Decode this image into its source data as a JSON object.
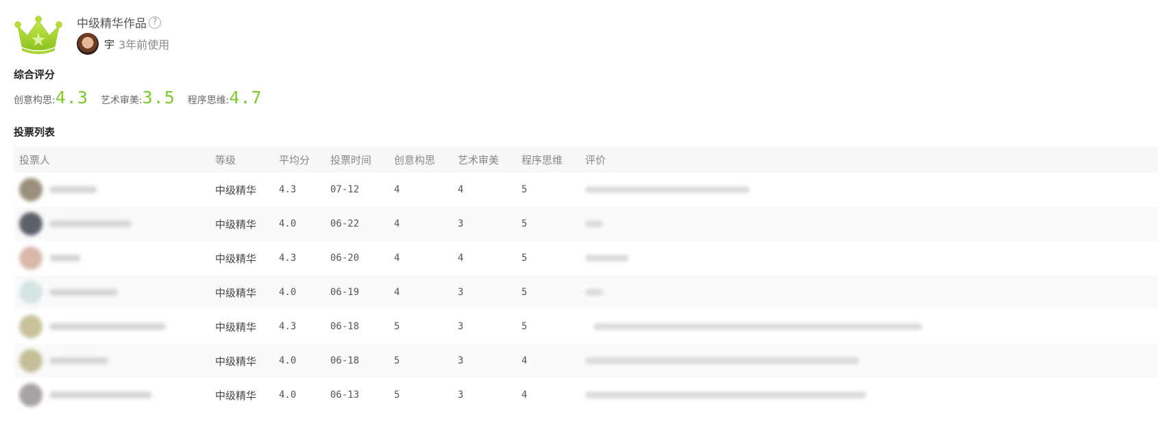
{
  "header": {
    "title": "中级精华作品",
    "help_icon": "question-circle-icon",
    "user_name": "宇",
    "user_time": "3年前使用"
  },
  "rating": {
    "section_title": "综合评分",
    "creativity_label": "创意构思:",
    "creativity_value": "4.3",
    "aesthetics_label": "艺术审美:",
    "aesthetics_value": "3.5",
    "programming_label": "程序思维:",
    "programming_value": "4.7",
    "accent_color": "#7acb2a"
  },
  "votes": {
    "section_title": "投票列表",
    "columns": [
      "投票人",
      "等级",
      "平均分",
      "投票时间",
      "创意构思",
      "艺术审美",
      "程序思维",
      "评价"
    ],
    "rows": [
      {
        "grade": "中级精华",
        "avg": "4.3",
        "time": "07-12",
        "c": "4",
        "a": "4",
        "p": "5"
      },
      {
        "grade": "中级精华",
        "avg": "4.0",
        "time": "06-22",
        "c": "4",
        "a": "3",
        "p": "5"
      },
      {
        "grade": "中级精华",
        "avg": "4.3",
        "time": "06-20",
        "c": "4",
        "a": "4",
        "p": "5"
      },
      {
        "grade": "中级精华",
        "avg": "4.0",
        "time": "06-19",
        "c": "4",
        "a": "3",
        "p": "5"
      },
      {
        "grade": "中级精华",
        "avg": "4.3",
        "time": "06-18",
        "c": "5",
        "a": "3",
        "p": "5"
      },
      {
        "grade": "中级精华",
        "avg": "4.0",
        "time": "06-18",
        "c": "5",
        "a": "3",
        "p": "4"
      },
      {
        "grade": "中级精华",
        "avg": "4.0",
        "time": "06-13",
        "c": "5",
        "a": "3",
        "p": "4"
      }
    ]
  }
}
